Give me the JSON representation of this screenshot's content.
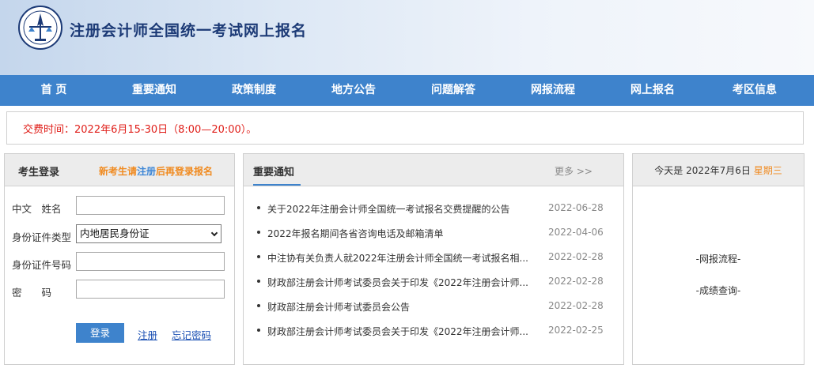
{
  "header": {
    "site_title": "注册会计师全国统一考试网上报名"
  },
  "nav": [
    {
      "label": "首 页"
    },
    {
      "label": "重要通知"
    },
    {
      "label": "政策制度"
    },
    {
      "label": "地方公告"
    },
    {
      "label": "问题解答"
    },
    {
      "label": "网报流程"
    },
    {
      "label": "网上报名"
    },
    {
      "label": "考区信息"
    }
  ],
  "notice": {
    "text": "交费时间：2022年6月15-30日（8:00—20:00）。"
  },
  "login": {
    "title": "考生登录",
    "hint_prefix": "新考生请",
    "hint_link": "注册",
    "hint_suffix": "后再登录报名",
    "name_label": "中文　姓名",
    "id_type_label": "身份证件类型",
    "id_type_value": "内地居民身份证",
    "id_no_label": "身份证件号码",
    "password_label": "密　　码",
    "name_value": "",
    "id_no_value": "",
    "password_value": "",
    "login_button": "登录",
    "register_link": "注册",
    "forgot_link": "忘记密码"
  },
  "news": {
    "title": "重要通知",
    "more": "更多 >>",
    "items": [
      {
        "title": "关于2022年注册会计师全国统一考试报名交费提醒的公告",
        "date": "2022-06-28"
      },
      {
        "title": "2022年报名期间各省咨询电话及邮箱清单",
        "date": "2022-04-06"
      },
      {
        "title": "中注协有关负责人就2022年注册会计师全国统一考试报名相...",
        "date": "2022-02-28"
      },
      {
        "title": "财政部注册会计师考试委员会关于印发《2022年注册会计师...",
        "date": "2022-02-28"
      },
      {
        "title": "财政部注册会计师考试委员会公告",
        "date": "2022-02-28"
      },
      {
        "title": "财政部注册会计师考试委员会关于印发《2022年注册会计师...",
        "date": "2022-02-25"
      }
    ]
  },
  "side": {
    "today_prefix": "今天是 2022年7月6日",
    "weekday": "星期三",
    "links": [
      "-网报流程-",
      "-成绩查询-"
    ]
  },
  "colors": {
    "nav_bg": "#3e83cc",
    "notice_red": "#e0201b",
    "accent_orange": "#f08a1f",
    "title_blue": "#1c3a76"
  },
  "icons": {
    "logo": "cicpa-emblem-icon",
    "select_arrow": "chevron-down-icon"
  }
}
